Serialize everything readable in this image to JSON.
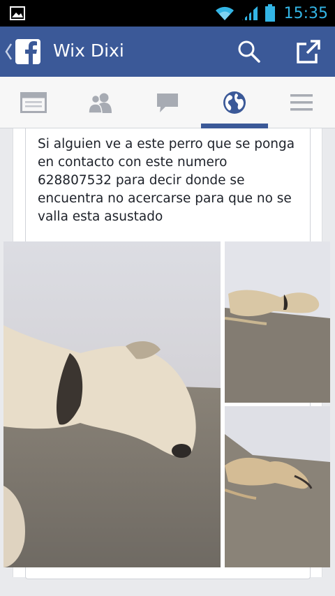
{
  "status_bar": {
    "time": "15:35",
    "time_color": "#33b5e5",
    "icons": [
      "gallery-icon",
      "wifi-icon",
      "signal-icon",
      "battery-icon"
    ]
  },
  "app_bar": {
    "title": "Wix Dixi",
    "background": "#3b5998",
    "icons": [
      "back-chevron-icon",
      "facebook-logo-icon",
      "search-icon",
      "share-icon"
    ]
  },
  "tabs": [
    {
      "name": "news-feed",
      "icon": "news-feed-icon",
      "active": false
    },
    {
      "name": "friends",
      "icon": "friends-icon",
      "active": false
    },
    {
      "name": "messages",
      "icon": "messages-icon",
      "active": false
    },
    {
      "name": "notifications",
      "icon": "globe-icon",
      "active": true
    },
    {
      "name": "more",
      "icon": "menu-icon",
      "active": false
    }
  ],
  "post": {
    "text_lines": [
      "Si alguien ve a este perro que se ponga",
      "en contacto con este numero",
      "628807532 para decir donde se",
      "encuentra no acercarse para que no se",
      "valla esta asustado"
    ],
    "photos": [
      {
        "description": "dog-closeup-photo"
      },
      {
        "description": "dog-lying-wall-photo"
      },
      {
        "description": "dog-lying-corner-photo"
      }
    ]
  }
}
